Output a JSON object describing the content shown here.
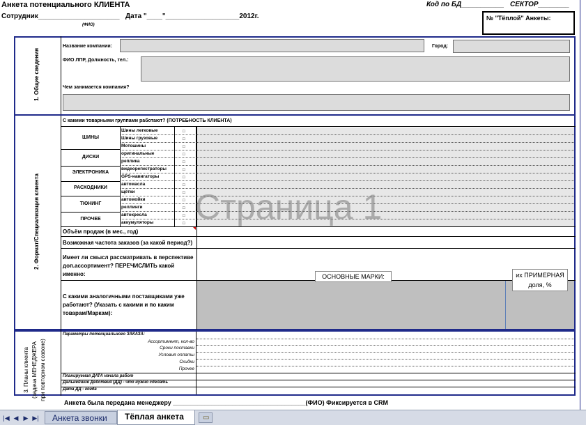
{
  "header": {
    "title": "Анкета потенциального КЛИЕНТА",
    "employee_line": "Сотрудник_____________________",
    "fio_hint": "(ФИО)",
    "date_line": "Дата \"____\"___________________2012г.",
    "db_code_line": "Код по БД___________",
    "sector_line": "СЕКТОР________",
    "warm_box": "№ \"Тёплой\" Анкеты:"
  },
  "section1": {
    "label": "1.  Общие сведения",
    "company_name": "Название компании:",
    "city": "Город:",
    "fio_lpr": "ФИО ЛПР, Должность, тел.:",
    "company_activity": "Чем занимается компания?"
  },
  "section2": {
    "label": "2. Формат/Специализация клиента",
    "groups_header": "С какими товарными группами работают?  (ПОТРЕБНОСТЬ КЛИЕНТА)",
    "categories": [
      {
        "name": "ШИНЫ",
        "subs": [
          "Шины легковые",
          "Шины грузовые"
        ]
      },
      {
        "name": "ДИСКИ",
        "subs": [
          "Мотошины",
          "оригинальные",
          "реплика"
        ]
      },
      {
        "name": "ЭЛЕКТРОНИКА",
        "subs": [
          "видеорегистраторы",
          "GPS-навигаторы"
        ]
      },
      {
        "name": "РАСХОДНИКИ",
        "subs": [
          "автомасла",
          "щётки"
        ]
      },
      {
        "name": "ТЮНИНГ",
        "subs": [
          "автомойки",
          "реллинги"
        ]
      },
      {
        "name": "ПРОЧЕЕ",
        "subs": [
          "автокресла",
          "аккумуляторы"
        ]
      }
    ],
    "sales_volume": "Объём продаж (в мес., год)",
    "order_frequency": "Возможная частота заказов (за какой период?)",
    "additional_assortment": "Имеет ли смысл рассматривать в перспективе доп.ассортимент? ПЕРЕЧИСЛИТЬ какой именно:",
    "competitors": "С какими аналогичными поставщиками уже работают? (Указать с какими и по каким товарам/Маркам):",
    "main_brands_popup": "ОСНОВНЫЕ МАРКИ:",
    "share_popup": "их ПРИМЕРНАЯ доля, %"
  },
  "section3": {
    "label": "3.  Планы клиента (задача МЕНЕДЖЕРА при повторном созвоне)",
    "order_params": "Параметры потенциального ЗАКАЗА:",
    "params": [
      "Ассортимент, кол-во",
      "Сроки поставки",
      "Условия оплаты",
      "Скидки",
      "Прочее"
    ],
    "start_date": "Планируемая ДАТА начала работ",
    "next_actions": "Дальнейшие Действия (ДД) -  что нужно сделать",
    "dd_date": "Дата ДД - когда"
  },
  "footer": {
    "handover": "Анкета была передана менеджеру ______________________________________(ФИО) Фиксируется в CRM"
  },
  "watermark": "Страница 1",
  "sheet_tabs": {
    "tabs": [
      "Анкета звонки",
      "Тёплая анкета"
    ],
    "active": "Тёплая анкета"
  }
}
